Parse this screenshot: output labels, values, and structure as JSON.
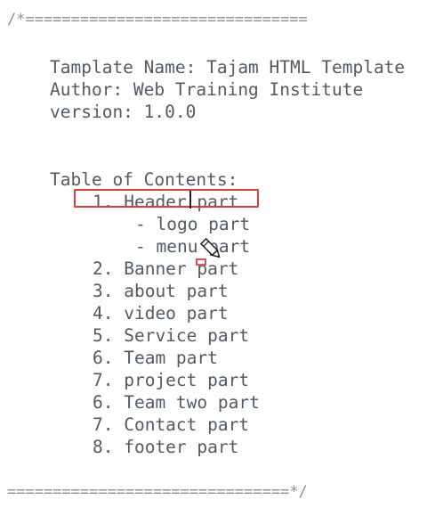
{
  "editor": {
    "comment_open": "/*===============================",
    "comment_close": "===============================*/",
    "template_name": "Tamplate Name: Tajam HTML Template",
    "author": "Author: Web Training Institute",
    "version": "version: 1.0.0",
    "toc_title": "Table of Contents:",
    "toc_items": [
      "1. Header part",
      "- logo part",
      "- menu part",
      "2. Banner part",
      "3. about part",
      "4. video part",
      "5. Service part",
      "6. Team part",
      "7. project part",
      "6. Team two part",
      "7. Contact part",
      "8. footer part"
    ]
  },
  "colors": {
    "text": "#555a5f",
    "highlight_border": "#e03b3b",
    "background": "#ffffff"
  },
  "icons": {
    "cursor": "pencil-cursor-icon"
  }
}
